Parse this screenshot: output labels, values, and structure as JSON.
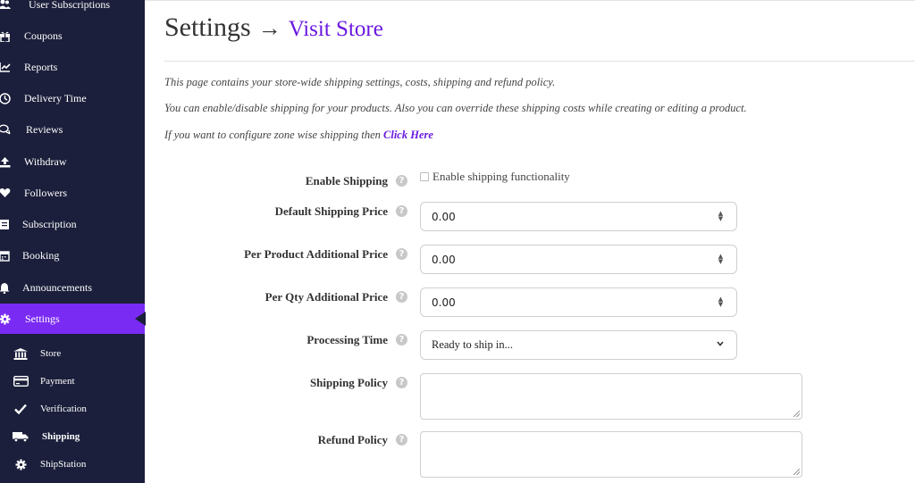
{
  "sidebar": {
    "items": [
      {
        "label": "User Subscriptions",
        "icon": "users-icon"
      },
      {
        "label": "Coupons",
        "icon": "gift-icon"
      },
      {
        "label": "Reports",
        "icon": "chart-icon"
      },
      {
        "label": "Delivery Time",
        "icon": "clock-icon"
      },
      {
        "label": "Reviews",
        "icon": "comments-icon"
      },
      {
        "label": "Withdraw",
        "icon": "upload-icon"
      },
      {
        "label": "Followers",
        "icon": "heart-icon"
      },
      {
        "label": "Subscription",
        "icon": "book-icon"
      },
      {
        "label": "Booking",
        "icon": "calendar-icon"
      },
      {
        "label": "Announcements",
        "icon": "bell-icon"
      },
      {
        "label": "Settings",
        "icon": "gear-icon",
        "active": true
      }
    ],
    "sub_items": [
      {
        "label": "Store",
        "icon": "bank-icon"
      },
      {
        "label": "Payment",
        "icon": "credit-card-icon"
      },
      {
        "label": "Verification",
        "icon": "check-icon"
      },
      {
        "label": "Shipping",
        "icon": "truck-icon",
        "current": true
      },
      {
        "label": "ShipStation",
        "icon": "gear-icon"
      }
    ]
  },
  "header": {
    "title": "Settings",
    "arrow": "→",
    "visit_store": "Visit Store"
  },
  "description": {
    "line1": "This page contains your store-wide shipping settings, costs, shipping and refund policy.",
    "line2": "You can enable/disable shipping for your products. Also you can override these shipping costs while creating or editing a product.",
    "line3_prefix": "If you want to configure zone wise shipping then",
    "line3_link": "Click Here"
  },
  "form": {
    "enable_shipping": {
      "label": "Enable Shipping",
      "checkbox_label": "Enable shipping functionality",
      "checked": false
    },
    "default_price": {
      "label": "Default Shipping Price",
      "value": "0.00"
    },
    "per_product": {
      "label": "Per Product Additional Price",
      "value": "0.00"
    },
    "per_qty": {
      "label": "Per Qty Additional Price",
      "value": "0.00"
    },
    "processing_time": {
      "label": "Processing Time",
      "value": "Ready to ship in..."
    },
    "shipping_policy": {
      "label": "Shipping Policy",
      "value": ""
    },
    "refund_policy": {
      "label": "Refund Policy",
      "value": ""
    }
  },
  "colors": {
    "sidebar_bg": "#1b1f3b",
    "accent": "#7a2bf3",
    "link": "#6a17e0"
  }
}
